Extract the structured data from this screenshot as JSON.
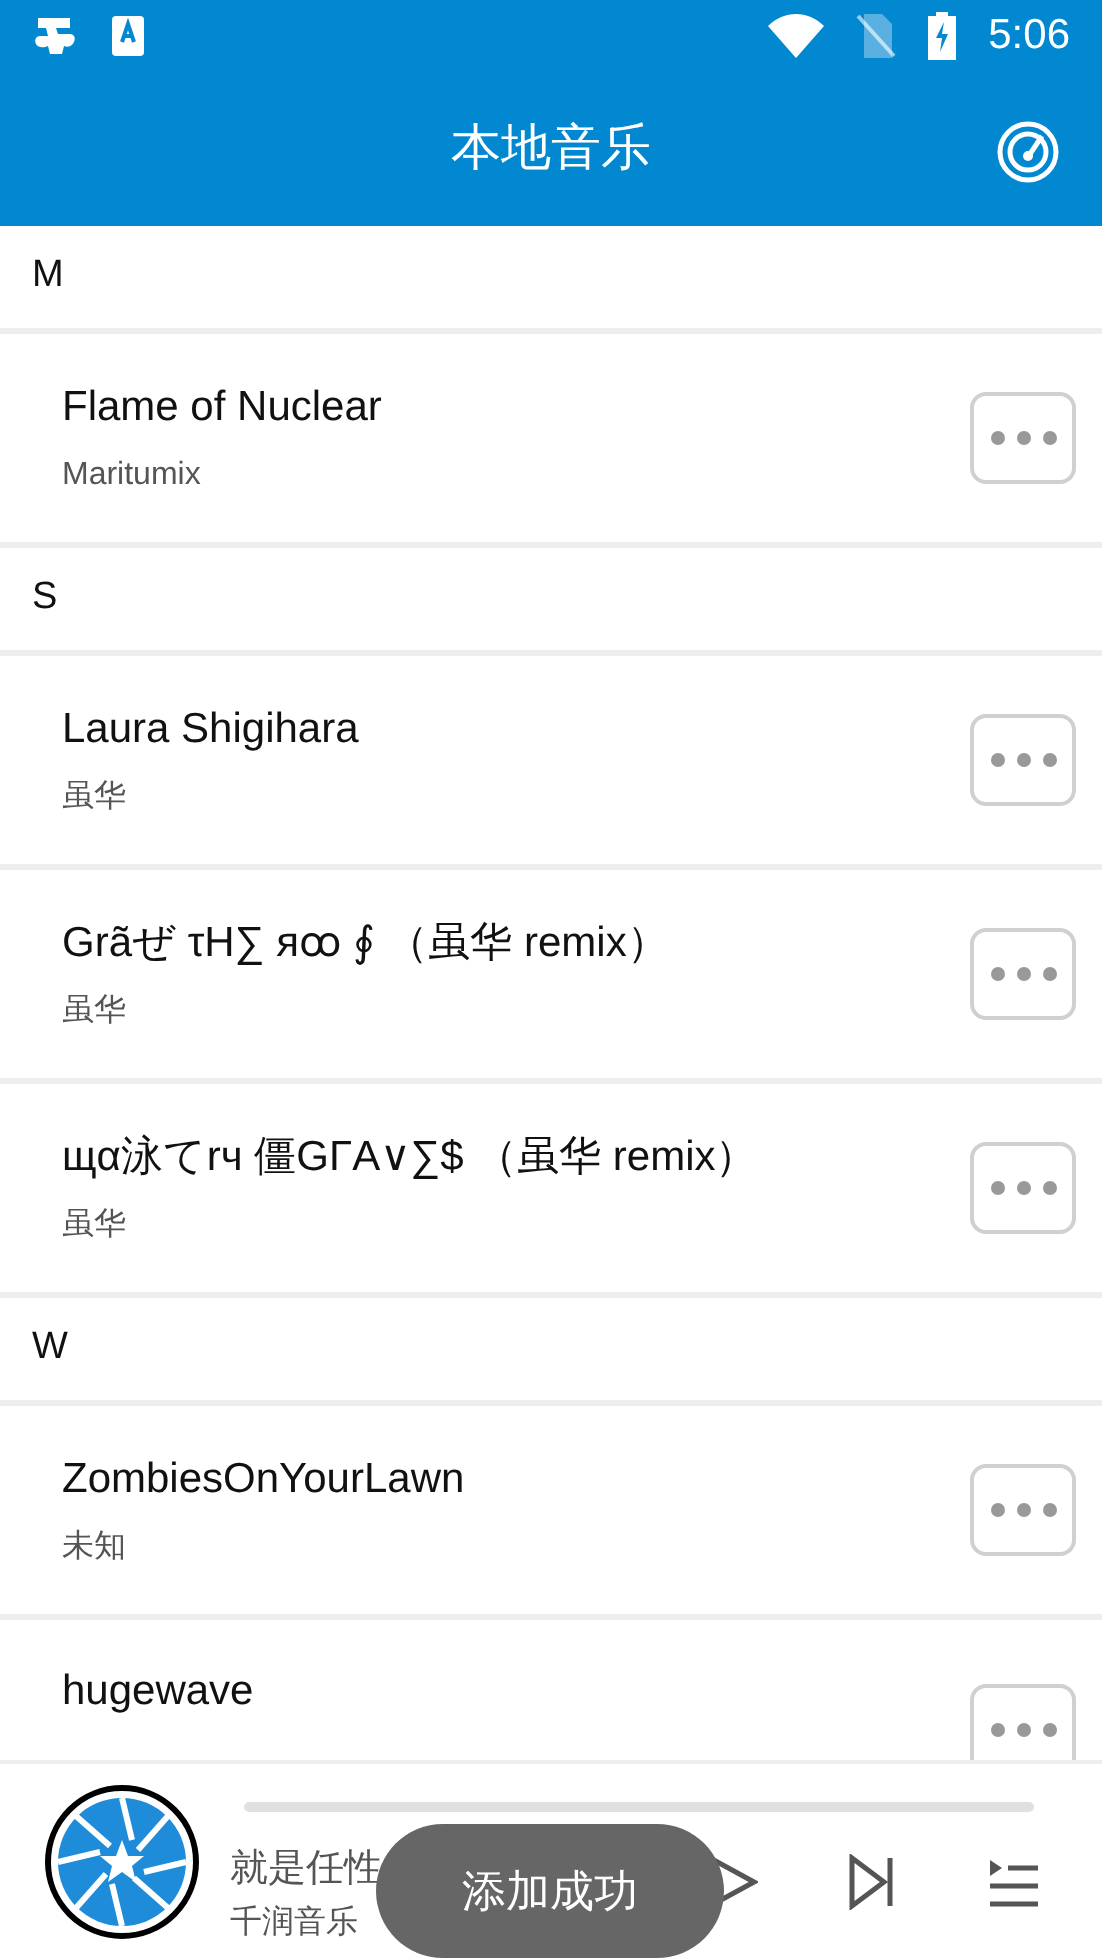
{
  "status_bar": {
    "time": "5:06"
  },
  "header": {
    "title": "本地音乐"
  },
  "sections": [
    {
      "letter": "M",
      "songs": [
        {
          "title": "Flame of Nuclear",
          "artist": "Maritumix"
        }
      ]
    },
    {
      "letter": "S",
      "songs": [
        {
          "title": "Laura Shigihara",
          "artist": "虽华"
        },
        {
          "title": "Grãぜ τH∑ яꝏ ∮ （虽华 remix）",
          "artist": "虽华"
        },
        {
          "title": "щα泳てrч 僵GΓA∨∑$ （虽华 remix）",
          "artist": "虽华"
        }
      ]
    },
    {
      "letter": "W",
      "songs": [
        {
          "title": "ZombiesOnYourLawn",
          "artist": "未知"
        },
        {
          "title": "hugewave"
        }
      ]
    }
  ],
  "player": {
    "title": "就是任性",
    "artist": "千润音乐"
  },
  "toast": {
    "text": "添加成功"
  }
}
